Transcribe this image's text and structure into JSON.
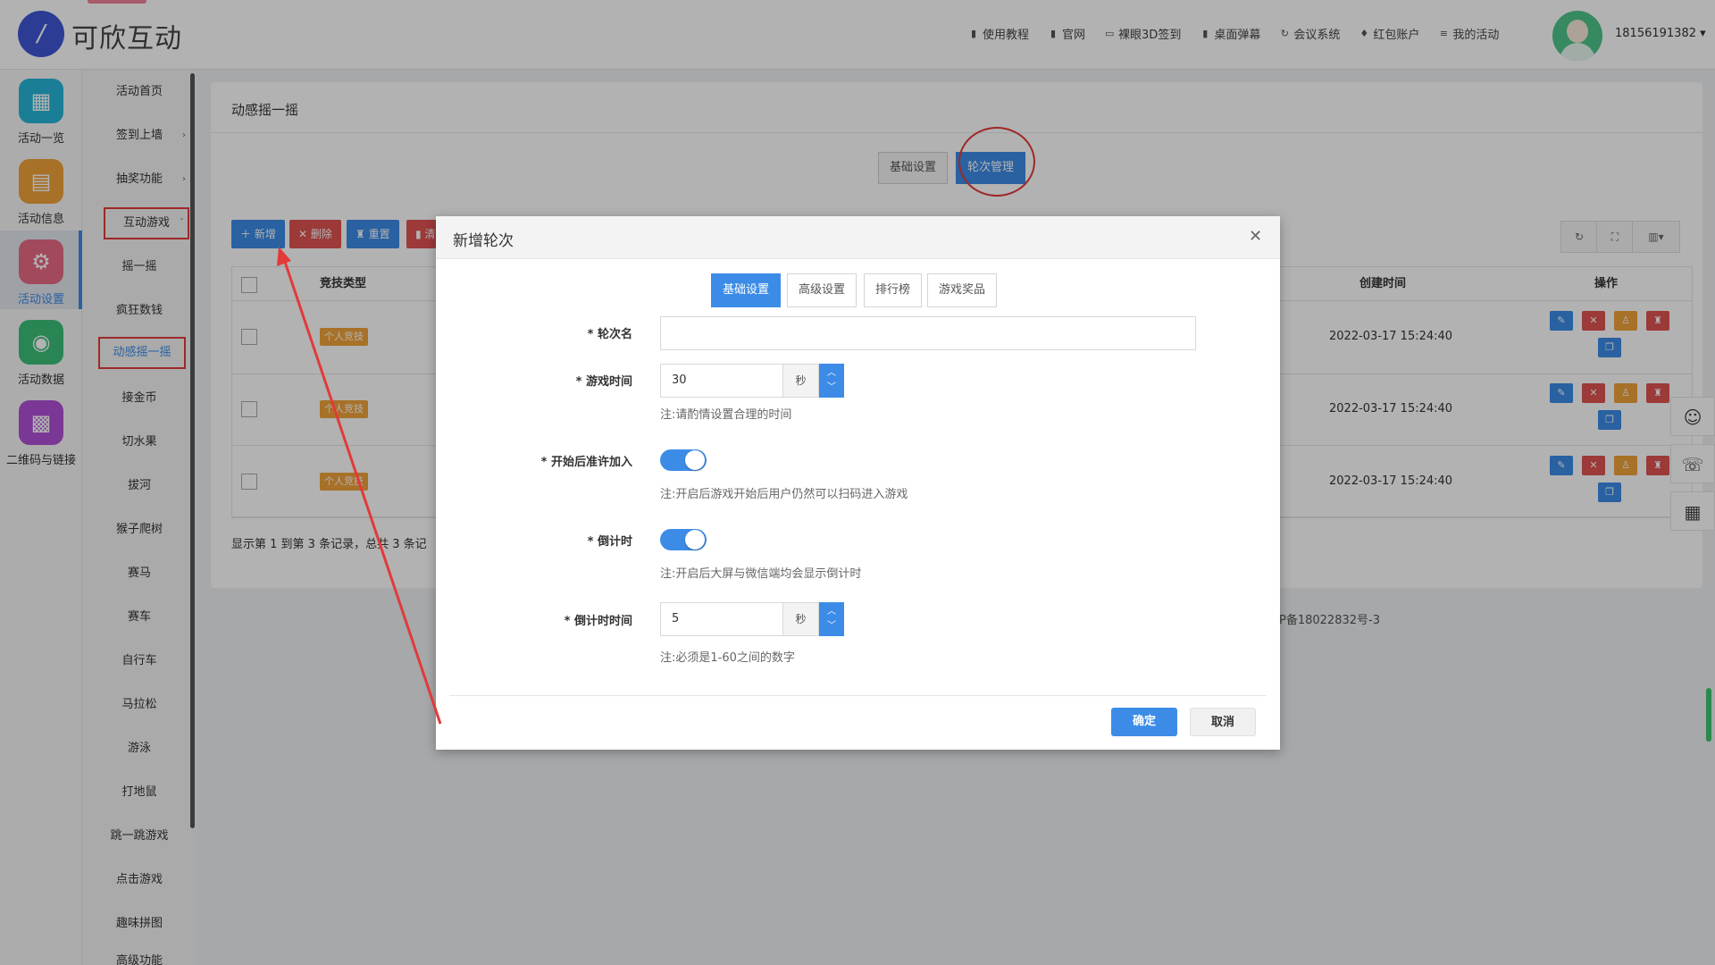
{
  "app": {
    "logo_text": "可欣互动",
    "logo_glyph": "/"
  },
  "topnav": [
    {
      "icon": "document-icon",
      "label": "使用教程"
    },
    {
      "icon": "document-icon",
      "label": "官网"
    },
    {
      "icon": "monitor-icon",
      "label": "裸眼3D签到"
    },
    {
      "icon": "document-icon",
      "label": "桌面弹幕"
    },
    {
      "icon": "refresh-icon",
      "label": "会议系统"
    },
    {
      "icon": "gift-icon",
      "label": "红包账户"
    },
    {
      "icon": "list-icon",
      "label": "我的活动"
    }
  ],
  "user": {
    "phone": "18156191382 ▾"
  },
  "rail": [
    {
      "label": "活动一览",
      "icon": "grid-icon",
      "color": "#26b7d7"
    },
    {
      "label": "活动信息",
      "icon": "doc-icon",
      "color": "#f0a33a"
    },
    {
      "label": "活动设置",
      "icon": "gear-icon",
      "color": "#e86a85"
    },
    {
      "label": "活动数据",
      "icon": "database-icon",
      "color": "#3bbf77"
    },
    {
      "label": "二维码与链接",
      "icon": "qrcode-icon",
      "color": "#b14fd6"
    }
  ],
  "submenu": [
    {
      "label": "活动首页"
    },
    {
      "label": "签到上墙",
      "chev": "›"
    },
    {
      "label": "抽奖功能",
      "chev": "›"
    },
    {
      "label": "互动游戏",
      "chev": "ˇ"
    },
    {
      "label": "摇一摇"
    },
    {
      "label": "疯狂数钱"
    },
    {
      "label": "动感摇一摇"
    },
    {
      "label": "接金币"
    },
    {
      "label": "切水果"
    },
    {
      "label": "拔河"
    },
    {
      "label": "猴子爬树"
    },
    {
      "label": "赛马"
    },
    {
      "label": "赛车"
    },
    {
      "label": "自行车"
    },
    {
      "label": "马拉松"
    },
    {
      "label": "游泳"
    },
    {
      "label": "打地鼠"
    },
    {
      "label": "跳一跳游戏"
    },
    {
      "label": "点击游戏"
    },
    {
      "label": "趣味拼图"
    },
    {
      "label": "高级功能"
    }
  ],
  "panel": {
    "title": "动感摇一摇",
    "tabs": [
      "基础设置",
      "轮次管理"
    ],
    "toolbar": {
      "add": "＋ 新增",
      "delete": "✕ 删除",
      "reset": "♜ 重置",
      "clear": "▮ 清"
    },
    "table": {
      "headers": {
        "type": "竞技类型",
        "created": "创建时间",
        "ops": "操作"
      },
      "rows": [
        {
          "type": "个人竞技",
          "created": "2022-03-17 15:24:40"
        },
        {
          "type": "个人竞技",
          "created": "2022-03-17 15:24:40"
        },
        {
          "type": "个人竞技",
          "created": "2022-03-17 15:24:40"
        }
      ]
    },
    "footer": "显示第 1 到第 3 条记录，总共 3 条记",
    "icp": "P备18022832号-3"
  },
  "modal": {
    "title": "新增轮次",
    "close": "✕",
    "tabs": [
      "基础设置",
      "高级设置",
      "排行榜",
      "游戏奖品"
    ],
    "fields": {
      "round_name": {
        "label": "* 轮次名",
        "value": ""
      },
      "game_time": {
        "label": "* 游戏时间",
        "value": "30",
        "unit": "秒",
        "note": "注:请酌情设置合理的时间"
      },
      "allow_join": {
        "label": "* 开始后准许加入",
        "note": "注:开启后游戏开始后用户仍然可以扫码进入游戏",
        "on": true
      },
      "countdown": {
        "label": "* 倒计时",
        "note": "注:开启后大屏与微信端均会显示倒计时",
        "on": true
      },
      "countdown_time": {
        "label": "* 倒计时时间",
        "value": "5",
        "unit": "秒",
        "note": "注:必须是1-60之间的数字"
      }
    },
    "ok": "确定",
    "cancel": "取消"
  },
  "colors": {
    "primary": "#3c8ce7",
    "danger": "#e23a3a",
    "warning": "#f0a33a"
  }
}
